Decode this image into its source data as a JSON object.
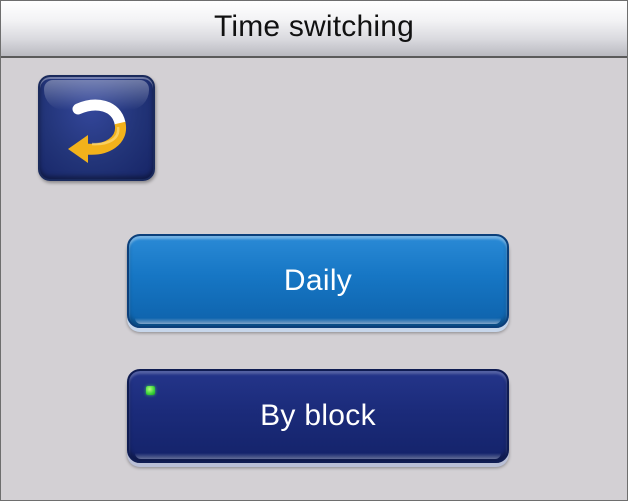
{
  "header": {
    "title": "Time switching"
  },
  "back_button": {
    "icon": "u-turn-back-arrow-icon",
    "arrow_color": "#f2b21b",
    "arrow_tail_color": "#ffffff"
  },
  "menu": {
    "options": [
      {
        "label": "Daily",
        "selected": false,
        "color": "#1676c4"
      },
      {
        "label": "By block",
        "selected": true,
        "indicator_color": "#39d23a",
        "color": "#1b2b7a"
      }
    ]
  }
}
